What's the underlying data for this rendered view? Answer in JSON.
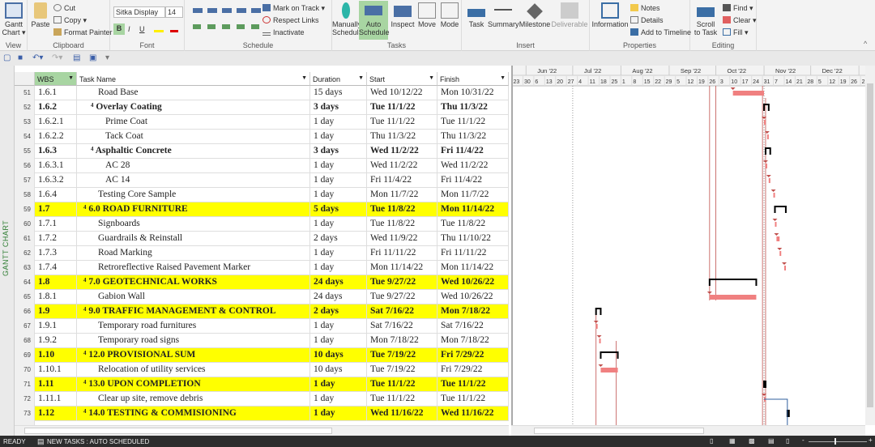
{
  "ribbon": {
    "view": {
      "label": "View",
      "gantt": "Gantt Chart ▾"
    },
    "clipboard": {
      "label": "Clipboard",
      "paste": "Paste",
      "cut": "Cut",
      "copy": "Copy ▾",
      "format_painter": "Format Painter"
    },
    "font": {
      "label": "Font",
      "family": "Sitka Display",
      "size": "14",
      "bold": "B",
      "italic": "I",
      "underline": "U"
    },
    "schedule": {
      "label": "Schedule",
      "mark_on_track": "Mark on Track ▾",
      "respect_links": "Respect Links",
      "inactivate": "Inactivate"
    },
    "tasks": {
      "label": "Tasks",
      "manually": "Manually Schedule",
      "auto": "Auto Schedule",
      "inspect": "Inspect",
      "move": "Move",
      "mode": "Mode"
    },
    "insert": {
      "label": "Insert",
      "task": "Task",
      "summary": "Summary",
      "milestone": "Milestone",
      "deliverable": "Deliverable"
    },
    "properties": {
      "label": "Properties",
      "information": "Information",
      "notes": "Notes",
      "details": "Details",
      "add_to_timeline": "Add to Timeline"
    },
    "editing": {
      "label": "Editing",
      "scroll": "Scroll to Task",
      "find": "Find ▾",
      "clear": "Clear ▾",
      "fill": "Fill ▾"
    }
  },
  "side_label": "GANTT CHART",
  "columns": {
    "wbs": "WBS",
    "name": "Task Name",
    "duration": "Duration",
    "start": "Start",
    "finish": "Finish"
  },
  "timescale": {
    "months": [
      {
        "label": "Jun '22",
        "date": "2022-06-01"
      },
      {
        "label": "Jul '22",
        "date": "2022-07-01"
      },
      {
        "label": "Aug '22",
        "date": "2022-08-01"
      },
      {
        "label": "Sep '22",
        "date": "2022-09-01"
      },
      {
        "label": "Oct '22",
        "date": "2022-10-01"
      },
      {
        "label": "Nov '22",
        "date": "2022-11-01"
      },
      {
        "label": "Dec '22",
        "date": "2022-12-01"
      },
      {
        "label": "Ja",
        "date": "2023-01-01"
      }
    ],
    "weeks": [
      "23",
      "30",
      "6",
      "13",
      "20",
      "27",
      "4",
      "11",
      "18",
      "25",
      "1",
      "8",
      "15",
      "22",
      "29",
      "5",
      "12",
      "19",
      "26",
      "3",
      "10",
      "17",
      "24",
      "31",
      "7",
      "14",
      "21",
      "28",
      "5",
      "12",
      "19",
      "26",
      "2"
    ]
  },
  "colors": {
    "highlight": "#ffff00",
    "task_bar": "#f08080",
    "summary": "#000000",
    "link": "#c0504d",
    "header_green": "#a8d5a2"
  },
  "rows": [
    {
      "id": "51",
      "wbs": "1.6.1",
      "name": "Road Base",
      "indent": 2,
      "duration": "15 days",
      "start": "Wed 10/12/22",
      "finish": "Mon 10/31/22",
      "s": "2022-10-12",
      "f": "2022-10-31",
      "type": "task"
    },
    {
      "id": "52",
      "wbs": "1.6.2",
      "name": "⁴ Overlay Coating",
      "indent": 1,
      "duration": "3 days",
      "start": "Tue 11/1/22",
      "finish": "Thu 11/3/22",
      "s": "2022-11-01",
      "f": "2022-11-03",
      "type": "summary"
    },
    {
      "id": "53",
      "wbs": "1.6.2.1",
      "name": "Prime Coat",
      "indent": 3,
      "duration": "1 day",
      "start": "Tue 11/1/22",
      "finish": "Tue 11/1/22",
      "s": "2022-11-01",
      "f": "2022-11-01",
      "type": "task"
    },
    {
      "id": "54",
      "wbs": "1.6.2.2",
      "name": "Tack Coat",
      "indent": 3,
      "duration": "1 day",
      "start": "Thu 11/3/22",
      "finish": "Thu 11/3/22",
      "s": "2022-11-03",
      "f": "2022-11-03",
      "type": "task"
    },
    {
      "id": "55",
      "wbs": "1.6.3",
      "name": "⁴ Asphaltic Concrete",
      "indent": 1,
      "duration": "3 days",
      "start": "Wed 11/2/22",
      "finish": "Fri 11/4/22",
      "s": "2022-11-02",
      "f": "2022-11-04",
      "type": "summary"
    },
    {
      "id": "56",
      "wbs": "1.6.3.1",
      "name": "AC 28",
      "indent": 3,
      "duration": "1 day",
      "start": "Wed 11/2/22",
      "finish": "Wed 11/2/22",
      "s": "2022-11-02",
      "f": "2022-11-02",
      "type": "task"
    },
    {
      "id": "57",
      "wbs": "1.6.3.2",
      "name": "AC 14",
      "indent": 3,
      "duration": "1 day",
      "start": "Fri 11/4/22",
      "finish": "Fri 11/4/22",
      "s": "2022-11-04",
      "f": "2022-11-04",
      "type": "task"
    },
    {
      "id": "58",
      "wbs": "1.6.4",
      "name": "Testing Core Sample",
      "indent": 2,
      "duration": "1 day",
      "start": "Mon 11/7/22",
      "finish": "Mon 11/7/22",
      "s": "2022-11-07",
      "f": "2022-11-07",
      "type": "task"
    },
    {
      "id": "59",
      "wbs": "1.7",
      "name": "⁴ 6.0 ROAD FURNITURE",
      "indent": 0,
      "duration": "5 days",
      "start": "Tue 11/8/22",
      "finish": "Mon 11/14/22",
      "s": "2022-11-08",
      "f": "2022-11-14",
      "type": "summary",
      "hl": true
    },
    {
      "id": "60",
      "wbs": "1.7.1",
      "name": "Signboards",
      "indent": 2,
      "duration": "1 day",
      "start": "Tue 11/8/22",
      "finish": "Tue 11/8/22",
      "s": "2022-11-08",
      "f": "2022-11-08",
      "type": "task"
    },
    {
      "id": "61",
      "wbs": "1.7.2",
      "name": "Guardrails & Reinstall",
      "indent": 2,
      "duration": "2 days",
      "start": "Wed 11/9/22",
      "finish": "Thu 11/10/22",
      "s": "2022-11-09",
      "f": "2022-11-10",
      "type": "task"
    },
    {
      "id": "62",
      "wbs": "1.7.3",
      "name": "Road Marking",
      "indent": 2,
      "duration": "1 day",
      "start": "Fri 11/11/22",
      "finish": "Fri 11/11/22",
      "s": "2022-11-11",
      "f": "2022-11-11",
      "type": "task"
    },
    {
      "id": "63",
      "wbs": "1.7.4",
      "name": "Retroreflective Raised Pavement Marker",
      "indent": 2,
      "duration": "1 day",
      "start": "Mon 11/14/22",
      "finish": "Mon 11/14/22",
      "s": "2022-11-14",
      "f": "2022-11-14",
      "type": "task"
    },
    {
      "id": "64",
      "wbs": "1.8",
      "name": "⁴ 7.0 GEOTECHNICAL WORKS",
      "indent": 0,
      "duration": "24 days",
      "start": "Tue 9/27/22",
      "finish": "Wed 10/26/22",
      "s": "2022-09-27",
      "f": "2022-10-26",
      "type": "summary",
      "hl": true
    },
    {
      "id": "65",
      "wbs": "1.8.1",
      "name": "Gabion Wall",
      "indent": 2,
      "duration": "24 days",
      "start": "Tue 9/27/22",
      "finish": "Wed 10/26/22",
      "s": "2022-09-27",
      "f": "2022-10-26",
      "type": "task"
    },
    {
      "id": "66",
      "wbs": "1.9",
      "name": "⁴ 9.0 TRAFFIC MANAGEMENT & CONTROL",
      "indent": 0,
      "duration": "2 days",
      "start": "Sat 7/16/22",
      "finish": "Mon 7/18/22",
      "s": "2022-07-16",
      "f": "2022-07-18",
      "type": "summary",
      "hl": true
    },
    {
      "id": "67",
      "wbs": "1.9.1",
      "name": "Temporary road furnitures",
      "indent": 2,
      "duration": "1 day",
      "start": "Sat 7/16/22",
      "finish": "Sat 7/16/22",
      "s": "2022-07-16",
      "f": "2022-07-16",
      "type": "task"
    },
    {
      "id": "68",
      "wbs": "1.9.2",
      "name": "Temporary road signs",
      "indent": 2,
      "duration": "1 day",
      "start": "Mon 7/18/22",
      "finish": "Mon 7/18/22",
      "s": "2022-07-18",
      "f": "2022-07-18",
      "type": "task"
    },
    {
      "id": "69",
      "wbs": "1.10",
      "name": "⁴ 12.0 PROVISIONAL SUM",
      "indent": 0,
      "duration": "10 days",
      "start": "Tue 7/19/22",
      "finish": "Fri 7/29/22",
      "s": "2022-07-19",
      "f": "2022-07-29",
      "type": "summary",
      "hl": true
    },
    {
      "id": "70",
      "wbs": "1.10.1",
      "name": "Relocation of utility services",
      "indent": 2,
      "duration": "10 days",
      "start": "Tue 7/19/22",
      "finish": "Fri 7/29/22",
      "s": "2022-07-19",
      "f": "2022-07-29",
      "type": "task"
    },
    {
      "id": "71",
      "wbs": "1.11",
      "name": "⁴ 13.0 UPON COMPLETION",
      "indent": 0,
      "duration": "1 day",
      "start": "Tue 11/1/22",
      "finish": "Tue 11/1/22",
      "s": "2022-11-01",
      "f": "2022-11-01",
      "type": "summary",
      "hl": true
    },
    {
      "id": "72",
      "wbs": "1.11.1",
      "name": "Clear up site, remove debris",
      "indent": 2,
      "duration": "1 day",
      "start": "Tue 11/1/22",
      "finish": "Tue 11/1/22",
      "s": "2022-11-01",
      "f": "2022-11-01",
      "type": "task"
    },
    {
      "id": "73",
      "wbs": "1.12",
      "name": "⁴ 14.0 TESTING & COMMISIONING",
      "indent": 0,
      "duration": "1 day",
      "start": "Wed 11/16/22",
      "finish": "Wed 11/16/22",
      "s": "2022-11-16",
      "f": "2022-11-16",
      "type": "summary",
      "hl": true
    }
  ],
  "status": {
    "ready": "READY",
    "new_tasks": "NEW TASKS : AUTO SCHEDULED"
  }
}
